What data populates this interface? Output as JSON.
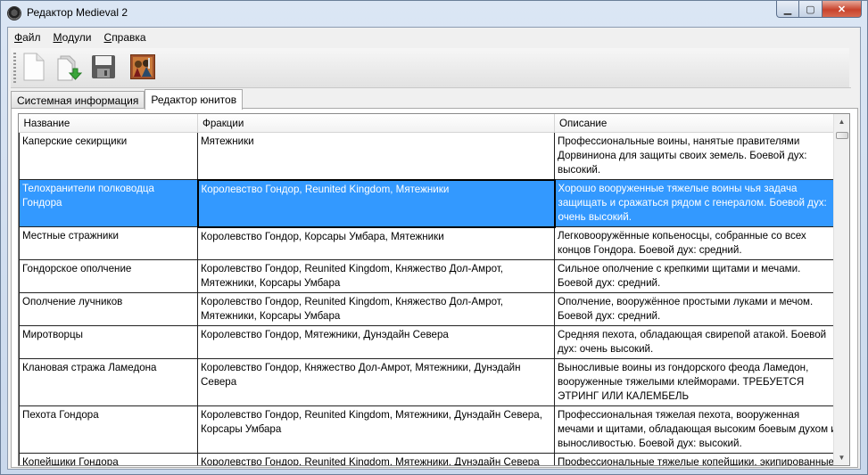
{
  "window": {
    "title": "Редактор Medieval 2",
    "minimize": "▁",
    "maximize": "▢",
    "close": "✕"
  },
  "menu": [
    {
      "label": "Файл",
      "accel": "Ф",
      "rest": "айл"
    },
    {
      "label": "Модули",
      "accel": "М",
      "rest": "одули"
    },
    {
      "label": "Справка",
      "accel": "С",
      "rest": "правка"
    }
  ],
  "toolbar": {
    "icons": [
      "new-file-icon",
      "open-file-icon",
      "save-icon",
      "unit-portrait-icon"
    ]
  },
  "tabs": [
    {
      "label": "Системная информация",
      "active": false
    },
    {
      "label": "Редактор юнитов",
      "active": true
    }
  ],
  "grid": {
    "columns": [
      "Название",
      "Фракции",
      "Описание"
    ],
    "rows": [
      {
        "name": "Каперские секирщики",
        "factions": "Мятежники",
        "description": "Профессиональные воины, нанятые правителями Дорвиниона для защиты своих земель. Боевой дух: высокий."
      },
      {
        "name": "Телохранители полководца Гондора",
        "factions": "Королевство Гондор, Reunited Kingdom, Мятежники",
        "description": "Хорошо вооруженные тяжелые воины чья задача защищать и сражаться рядом с генералом. Боевой дух: очень высокий.",
        "selected": true
      },
      {
        "name": "Местные стражники",
        "factions": "Королевство Гондор, Корсары Умбара, Мятежники",
        "description": "Легковооружённые копьеносцы, собранные со всех концов Гондора. Боевой дух: средний."
      },
      {
        "name": "Гондорское ополчение",
        "factions": "Королевство Гондор, Reunited Kingdom, Княжество Дол-Амрот, Мятежники, Корсары Умбара",
        "description": "Сильное ополчение с крепкими щитами и мечами. Боевой дух: средний."
      },
      {
        "name": "Ополчение лучников",
        "factions": "Королевство Гондор, Reunited Kingdom, Княжество Дол-Амрот, Мятежники, Корсары Умбара",
        "description": "Ополчение, вооружённое простыми луками и мечом. Боевой дух: средний."
      },
      {
        "name": "Миротворцы",
        "factions": "Королевство Гондор, Мятежники, Дунэдайн Севера",
        "description": "Средняя пехота, обладающая свирепой атакой. Боевой дух: очень высокий."
      },
      {
        "name": "Клановая стража Ламедона",
        "factions": "Королевство Гондор, Княжество Дол-Амрот, Мятежники, Дунэдайн Севера",
        "description": "Выносливые воины из гондорского феода Ламедон, вооруженные тяжелыми клейморами. ТРЕБУЕТСЯ ЭТРИНГ ИЛИ КАЛЕМБЕЛЬ"
      },
      {
        "name": "Пехота Гондора",
        "factions": "Королевство Гондор, Reunited Kingdom, Мятежники, Дунэдайн Севера, Корсары Умбара",
        "description": "Профессиональная тяжелая пехота, вооруженная мечами и щитами, обладающая высоким боевым духом и выносливостью. Боевой дух: высокий."
      },
      {
        "name": "Копейщики Гондора",
        "factions": "Королевство Гондор, Reunited Kingdom, Мятежники, Дунэдайн Севера",
        "description": "Профессиональные тяжелые копейщики, экипированные пластинчатым доспехом, крепким"
      }
    ]
  }
}
